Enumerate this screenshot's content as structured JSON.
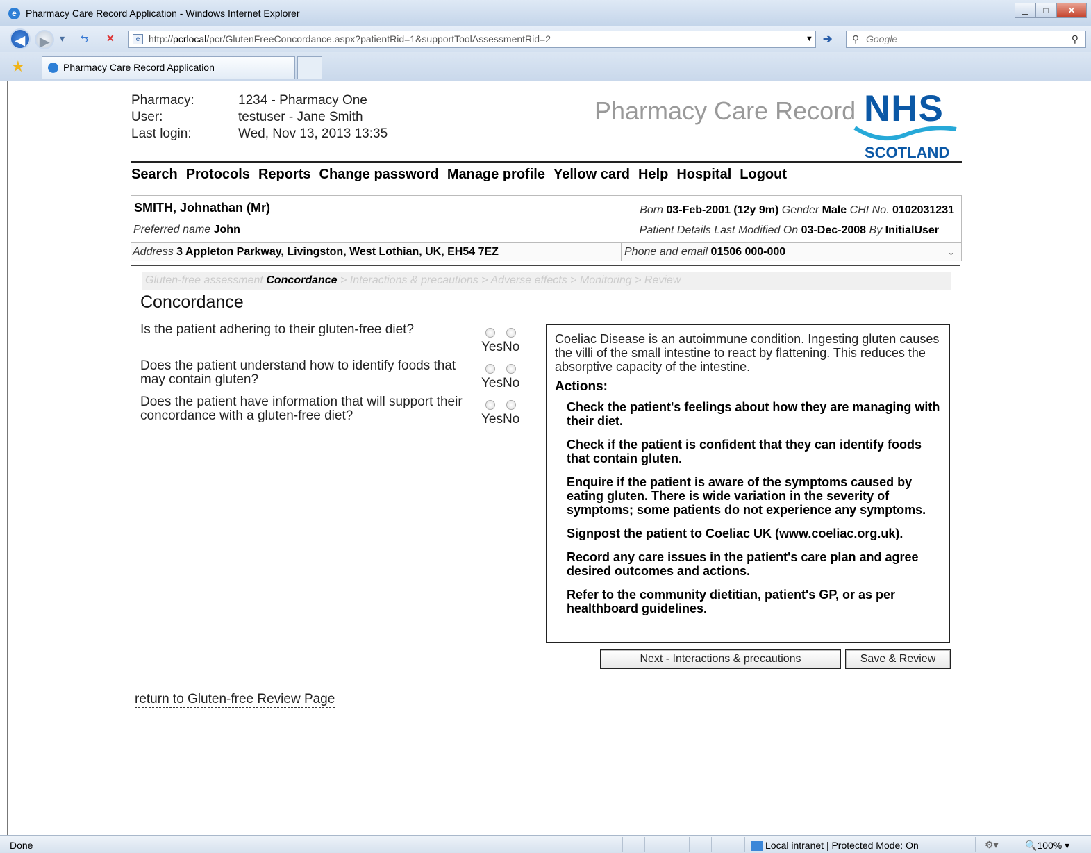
{
  "browser": {
    "window_title": "Pharmacy Care Record Application - Windows Internet Explorer",
    "url_prefix": "http://",
    "url_host": "pcrlocal",
    "url_path": "/pcr/GlutenFreeConcordance.aspx?patientRid=1&supportToolAssessmentRid=2",
    "search_placeholder": "Google",
    "tab_label": "Pharmacy Care Record Application",
    "status_text": "Done",
    "zone_text": "Local intranet | Protected Mode: On",
    "zoom": "100%"
  },
  "header": {
    "pharmacy_label": "Pharmacy:",
    "pharmacy_value": "1234 - Pharmacy One",
    "user_label": "User:",
    "user_value": "testuser - Jane Smith",
    "last_login_label": "Last login:",
    "last_login_value": "Wed, Nov 13, 2013 13:35",
    "app_title": "Pharmacy Care Record",
    "logo_top": "NHS",
    "logo_bottom": "SCOTLAND"
  },
  "nav": [
    "Search",
    "Protocols",
    "Reports",
    "Change password",
    "Manage profile",
    "Yellow card",
    "Help",
    "Hospital",
    "Logout"
  ],
  "patient": {
    "name": "SMITH, Johnathan (Mr)",
    "preferred_label": "Preferred name",
    "preferred_value": "John",
    "born_label": "Born",
    "born_value": "03-Feb-2001",
    "age": "(12y 9m)",
    "gender_label": "Gender",
    "gender_value": "Male",
    "chi_label": "CHI No.",
    "chi_value": "0102031231",
    "modified_label": "Patient Details Last Modified On",
    "modified_value": "03-Dec-2008",
    "by_label": "By",
    "by_value": "InitialUser",
    "address_label": "Address",
    "address_value": "3 Appleton Parkway, Livingston, West Lothian, UK, EH54 7EZ",
    "phone_label": "Phone and email",
    "phone_value": "01506 000-000"
  },
  "breadcrumb": {
    "step1": "Gluten-free assessment",
    "current": "Concordance",
    "rest": "> Interactions & precautions > Adverse effects > Monitoring > Review"
  },
  "page_title": "Concordance",
  "questions": [
    {
      "text": "Is the patient adhering to their gluten-free diet?",
      "yes": "Yes",
      "no": "No"
    },
    {
      "text": "Does the patient understand how to identify foods that may contain gluten?",
      "yes": "Yes",
      "no": "No"
    },
    {
      "text": "Does the patient have information that will support their concordance with a gluten-free diet?",
      "yes": "Yes",
      "no": "No"
    }
  ],
  "info": {
    "intro": "Coeliac Disease is an autoimmune condition. Ingesting gluten causes the villi of the small intestine to react by flattening. This reduces the absorptive capacity of the intestine.",
    "actions_label": "Actions:",
    "actions": [
      "Check the patient's feelings about how they are managing with their diet.",
      "Check if the patient is confident that they can identify foods that contain gluten.",
      "Enquire if the patient is aware of the symptoms caused by eating gluten. There is wide variation in the severity of symptoms; some patients do not experience any symptoms.",
      "Signpost the patient to Coeliac UK (www.coeliac.org.uk).",
      "Record any care issues in the patient's care plan and agree desired outcomes and actions.",
      "Refer to the community dietitian, patient's GP, or as per healthboard guidelines."
    ]
  },
  "buttons": {
    "next": "Next - Interactions & precautions",
    "save": "Save & Review"
  },
  "return_link": "return to Gluten-free Review Page"
}
